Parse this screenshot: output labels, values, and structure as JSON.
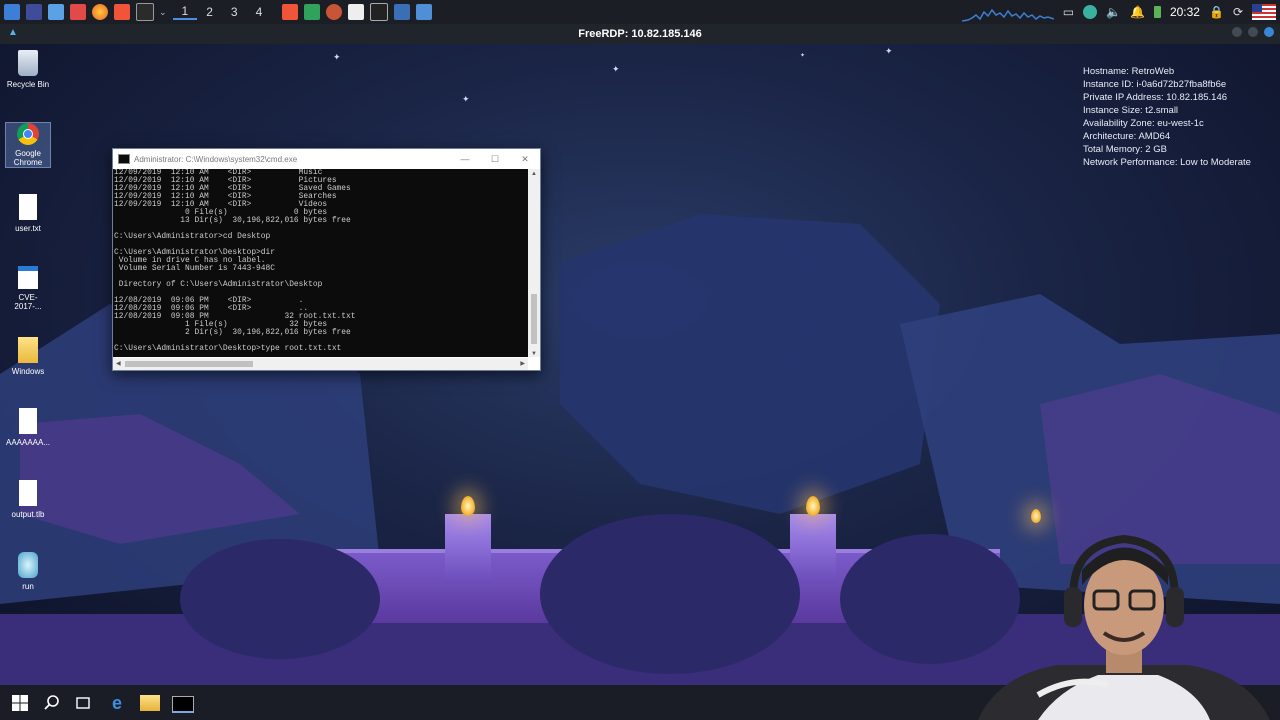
{
  "top_panel": {
    "workspaces": [
      "1",
      "2",
      "3",
      "4"
    ],
    "active_workspace": "1",
    "clock": "20:32",
    "launcher_icons": [
      "start-menu-icon",
      "terminal-icon",
      "files-icon",
      "pdf-icon",
      "firefox-icon",
      "brave-icon",
      "shell-icon"
    ],
    "tray_icons": [
      "screen-icon",
      "app-icon",
      "volume-icon",
      "bell-icon",
      "battery-icon",
      "lock-icon",
      "refresh-icon",
      "us-flag-icon"
    ]
  },
  "rdp": {
    "title": "FreeRDP: 10.82.185.146"
  },
  "desktop_icons": [
    {
      "label": "Recycle Bin",
      "icon": "recycle-bin-icon"
    },
    {
      "label": "Google Chrome",
      "icon": "chrome-icon"
    },
    {
      "label": "user.txt",
      "icon": "text-file-icon"
    },
    {
      "label": "CVE-2017-...",
      "icon": "app-window-icon"
    },
    {
      "label": "Windows",
      "icon": "folder-icon"
    },
    {
      "label": "AAAAAAA...",
      "icon": "blank-file-icon"
    },
    {
      "label": "output.tlb",
      "icon": "blank-file-icon"
    },
    {
      "label": "run",
      "icon": "run-icon"
    }
  ],
  "sysinfo": [
    "Hostname: RetroWeb",
    "Instance ID: i-0a6d72b27fba8fb6e",
    "Private IP Address: 10.82.185.146",
    "Instance Size: t2.small",
    "Availability Zone: eu-west-1c",
    "Architecture: AMD64",
    "Total Memory: 2 GB",
    "Network Performance: Low to Moderate"
  ],
  "cmd": {
    "title": "Administrator: C:\\Windows\\system32\\cmd.exe",
    "output": "12/09/2019  12:10 AM    <DIR>          Music\n12/09/2019  12:10 AM    <DIR>          Pictures\n12/09/2019  12:10 AM    <DIR>          Saved Games\n12/09/2019  12:10 AM    <DIR>          Searches\n12/09/2019  12:10 AM    <DIR>          Videos\n               0 File(s)              0 bytes\n              13 Dir(s)  30,196,822,016 bytes free\n\nC:\\Users\\Administrator>cd Desktop\n\nC:\\Users\\Administrator\\Desktop>dir\n Volume in drive C has no label.\n Volume Serial Number is 7443-948C\n\n Directory of C:\\Users\\Administrator\\Desktop\n\n12/08/2019  09:06 PM    <DIR>          .\n12/08/2019  09:06 PM    <DIR>          ..\n12/08/2019  09:08 PM                32 root.txt.txt\n               1 File(s)             32 bytes\n               2 Dir(s)  30,196,822,016 bytes free\n\nC:\\Users\\Administrator\\Desktop>type root.txt.txt"
  },
  "taskbar_icons": [
    "windows-start-icon",
    "search-icon",
    "task-view-icon",
    "edge-icon",
    "file-explorer-icon",
    "cmd-taskbar-icon"
  ]
}
